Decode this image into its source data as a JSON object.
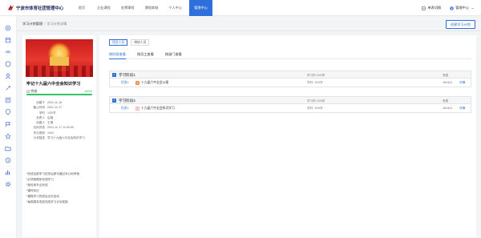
{
  "app": {
    "title": "宁波市体育社团管理中心"
  },
  "nav": [
    "首页",
    "企业课程",
    "金牌课程",
    "课程商城",
    "个人中心",
    "管理中心"
  ],
  "top_right": {
    "switch_label": "单表切换",
    "admin_label": "管理中心"
  },
  "breadcrumb": {
    "parent": "学习计划管理",
    "separator": "/",
    "current": "学习计划详情"
  },
  "create_button": "创建学习计划",
  "plan": {
    "title": "牢记十九届六中全会知识学习",
    "status": "完成",
    "progress_text": "10/10",
    "progress_fraction": 1.0,
    "info": [
      {
        "k": "创建于",
        "v": "2021-11-18"
      },
      {
        "k": "截止时间",
        "v": "2021-11-17"
      },
      {
        "k": "学时",
        "v": "1/20节"
      },
      {
        "k": "负责人",
        "v": "后端"
      },
      {
        "k": "创建人",
        "v": "王清"
      },
      {
        "k": "实际完成",
        "v": "2021-11-17 11:00:00"
      },
      {
        "k": "学分类别",
        "v": "1/0/0"
      },
      {
        "k": "计划描述",
        "v": "学习十九届六中全会知识学习"
      }
    ],
    "requirements": [
      "*完成全部学习任务后即可通过本计划考核",
      "*必须按顺序完成学习",
      "*按时间节点完成",
      "*课时标记",
      "*课程学习完成后当天自动",
      "*每周周末发放完成学习计划奖励"
    ]
  },
  "main": {
    "top_tabs": [
      "项目人员",
      "审核人员"
    ],
    "sub_tabs": [
      "按阶段查看",
      "按员工查看",
      "按部门查看"
    ],
    "phases": [
      {
        "name": "学习阶段1",
        "meta": "学习时 10/0学",
        "status": "完成",
        "rows": [
          {
            "task": "任务1",
            "name": "十九届六中全会公报",
            "study": "学时: 10/0学",
            "progress": "16/16人",
            "detail": "详情"
          }
        ]
      },
      {
        "name": "学习阶段2",
        "meta": "学习时 10/0学",
        "status": "完成",
        "rows": [
          {
            "task": "任务1",
            "name": "十九届六中全会知识学习",
            "study": "学时: 10/0学",
            "progress": "16/16人",
            "detail": "详情"
          }
        ]
      }
    ]
  },
  "colors": {
    "accent": "#2f6fdb",
    "success": "#35c26a",
    "nav_active": "#2f6fdb"
  },
  "sidebar_icons": [
    "home-icon",
    "calendar-icon",
    "chart-icon",
    "shield-icon",
    "people-icon",
    "settings-icon",
    "book-icon",
    "location-icon",
    "flag-icon",
    "star-icon",
    "folder-icon",
    "user-icon",
    "bar-chart-icon",
    "gear-icon"
  ]
}
